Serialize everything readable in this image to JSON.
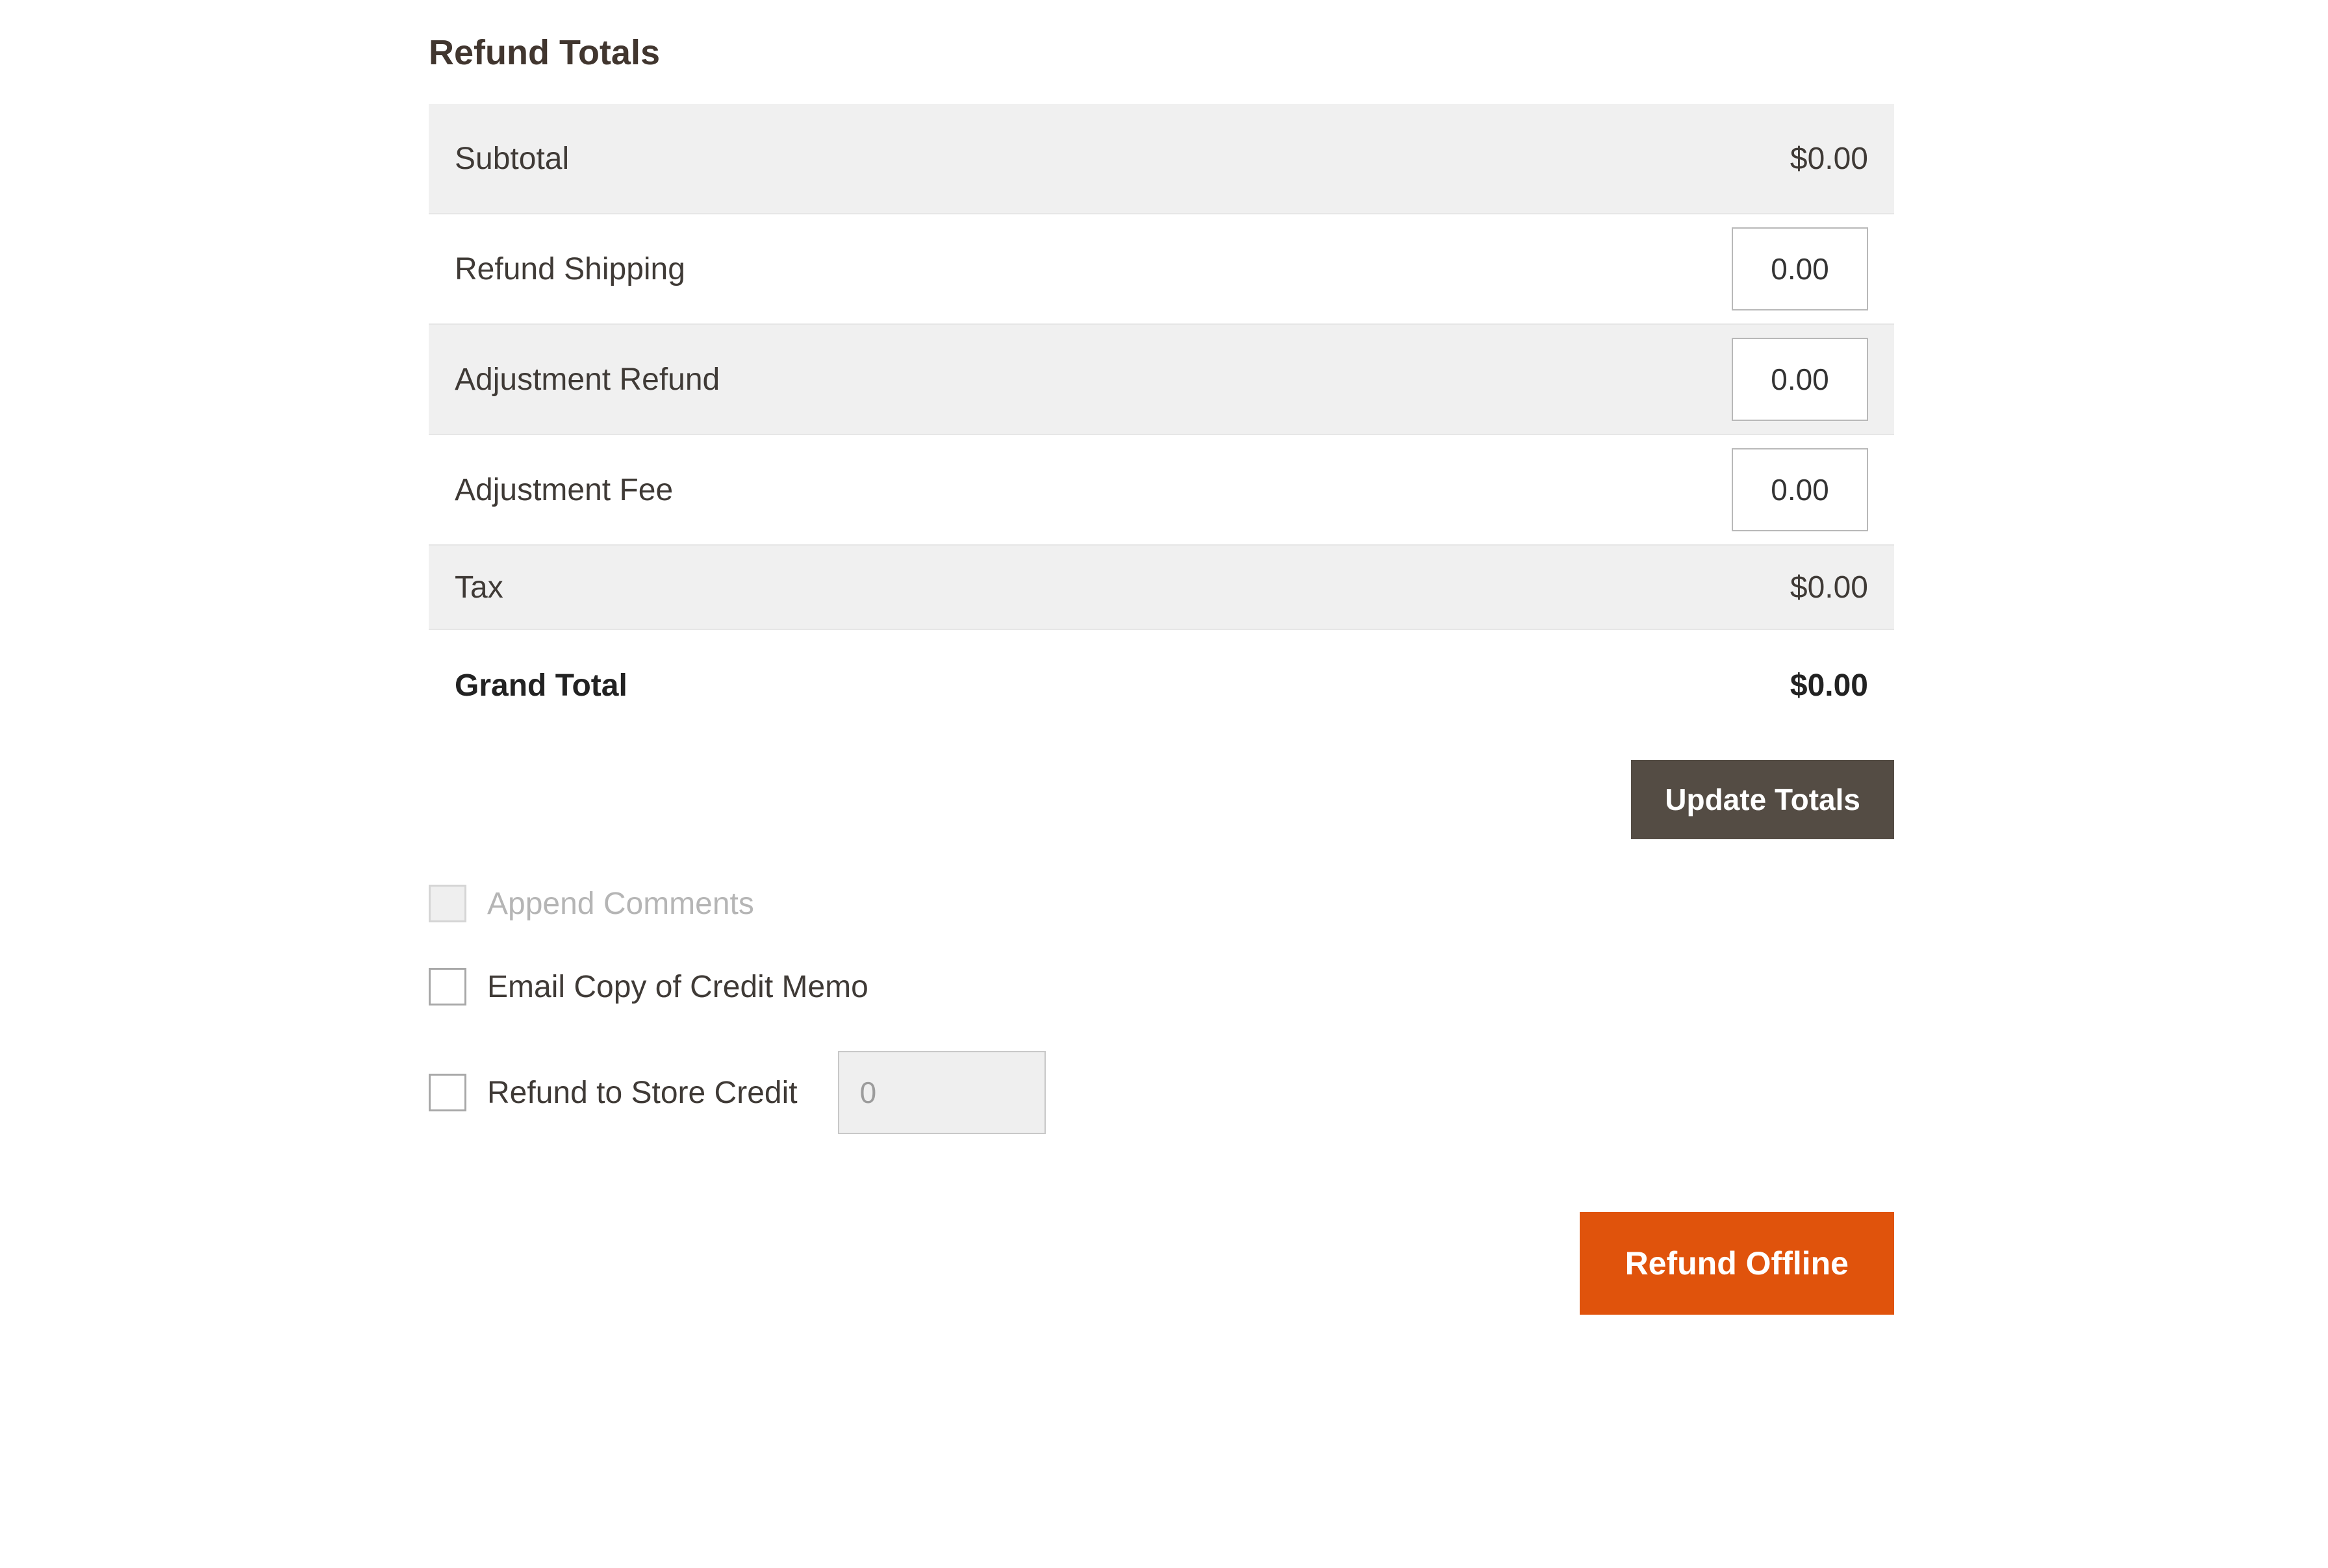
{
  "heading": "Refund Totals",
  "rows": {
    "subtotal": {
      "label": "Subtotal",
      "value": "$0.00"
    },
    "refund_shipping": {
      "label": "Refund Shipping",
      "input": "0.00"
    },
    "adjustment_refund": {
      "label": "Adjustment Refund",
      "input": "0.00"
    },
    "adjustment_fee": {
      "label": "Adjustment Fee",
      "input": "0.00"
    },
    "tax": {
      "label": "Tax",
      "value": "$0.00"
    },
    "grand_total": {
      "label": "Grand Total",
      "value": "$0.00"
    }
  },
  "buttons": {
    "update_totals": "Update Totals",
    "refund_offline": "Refund Offline"
  },
  "options": {
    "append_comments": {
      "label": "Append Comments"
    },
    "email_copy": {
      "label": "Email Copy of Credit Memo"
    },
    "refund_store_credit": {
      "label": "Refund to Store Credit",
      "placeholder": "0"
    }
  }
}
